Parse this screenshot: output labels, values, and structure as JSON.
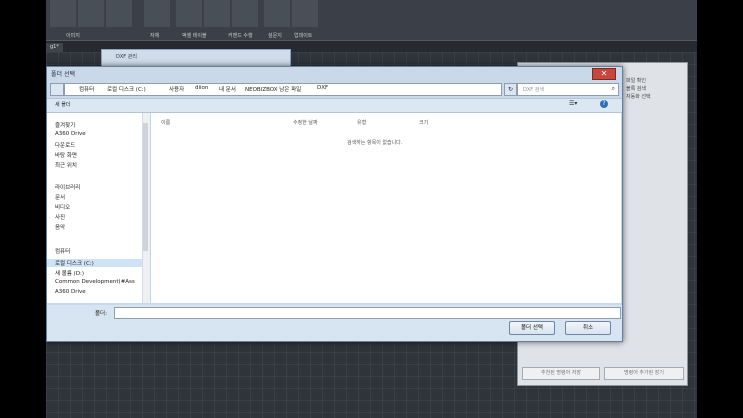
{
  "ribbon": {
    "labels": [
      "이미지",
      "자체",
      "액셀 테이블",
      "커맨드 수행",
      "설문지",
      "업데이트"
    ],
    "tab": "g1*"
  },
  "dxf_window": {
    "title": "DXF 관리"
  },
  "dialog": {
    "title": "폴더 선택",
    "close_symbol": "✕",
    "breadcrumbs": [
      "컴퓨터",
      "로컬 디스크 (C:)",
      "사용자",
      "diion",
      "내 문서",
      "NEOBIZBOX 남은 파일",
      "DXF"
    ],
    "search_placeholder": "DXF 검색",
    "new_folder": "새 폴더",
    "columns": [
      "이름",
      "수정한 날짜",
      "유형",
      "크기"
    ],
    "empty_message": "검색하는 항목이 없습니다.",
    "nav": {
      "favorites_header": "즐겨찾기",
      "favorites": [
        "A360 Drive",
        "다운로드",
        "바탕 화면",
        "최근 위치"
      ],
      "libraries_header": "라이브러리",
      "libraries": [
        "문서",
        "비디오",
        "사진",
        "음악"
      ],
      "computer_header": "컴퓨터",
      "computer": [
        "로컬 디스크 (C:)",
        "새 볼륨 (D:)",
        "Common Development(#Ass",
        "A360 Drive"
      ]
    },
    "filename_label": "폴더:",
    "select_button": "폴더 선택",
    "cancel_button": "취소"
  },
  "palette": {
    "lines": [
      "파일 확인",
      "블록 검색",
      "자동화 선택"
    ],
    "button1": "추천된 명령어 저장",
    "button2": "명령어 추가된 장기"
  }
}
